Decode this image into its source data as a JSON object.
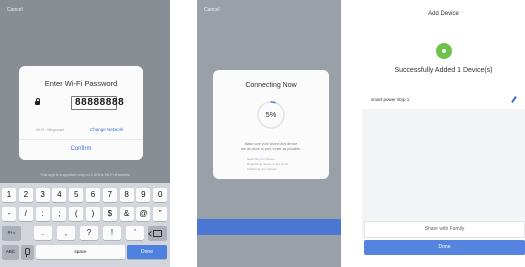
{
  "screen1": {
    "cancel_label": "Cancel",
    "dialog_title": "Enter Wi-Fi Password",
    "password_value": "88888888",
    "wifi_label": "Wi-Fi : Wingsmart",
    "change_network_label": "Change Network",
    "confirm_label": "Confirm",
    "note": "This app is supported only on 2.4GHz Wi-Fi channels",
    "keyboard": {
      "row1": [
        "1",
        "2",
        "3",
        "4",
        "5",
        "6",
        "7",
        "8",
        "9",
        "0"
      ],
      "row2": [
        "-",
        "/",
        ":",
        ";",
        "(",
        ")",
        "$",
        "&",
        "@",
        "\""
      ],
      "row3_mode": "#+=",
      "row3": [
        ".",
        ",",
        "?",
        "!",
        "'"
      ],
      "abc_label": "ABC",
      "space_label": "space",
      "done_label": "Done"
    }
  },
  "screen2": {
    "cancel_label": "Cancel",
    "dialog_title": "Connecting Now",
    "progress_text": "5%",
    "progress_fraction": 0.05,
    "hint_line1": "Make sure your phone and device",
    "hint_line2": "are as close to your router as possible.",
    "steps": [
      "Searching for Device",
      "Registering device to the cloud",
      "Initializing your Device"
    ]
  },
  "screen3": {
    "header_title": "Add Device",
    "success_text": "Successfully Added 1 Device(s)",
    "device_name": "smart power strip 1",
    "share_label": "Share with Family",
    "done_label": "Done"
  },
  "colors": {
    "accent_blue": "#4f82e0",
    "success_green": "#6cc24a"
  }
}
